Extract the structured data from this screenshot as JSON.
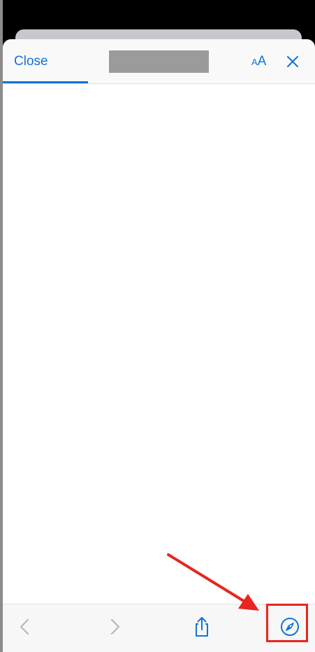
{
  "header": {
    "close_label": "Close",
    "text_size_small": "A",
    "text_size_large": "A"
  },
  "icons": {
    "dismiss": "close-x-icon",
    "back": "chevron-left-icon",
    "forward": "chevron-right-icon",
    "share": "share-icon",
    "open_in_browser": "compass-icon"
  },
  "colors": {
    "accent": "#1273d8",
    "disabled": "#b8b8b8",
    "annotation": "#e8251f"
  }
}
